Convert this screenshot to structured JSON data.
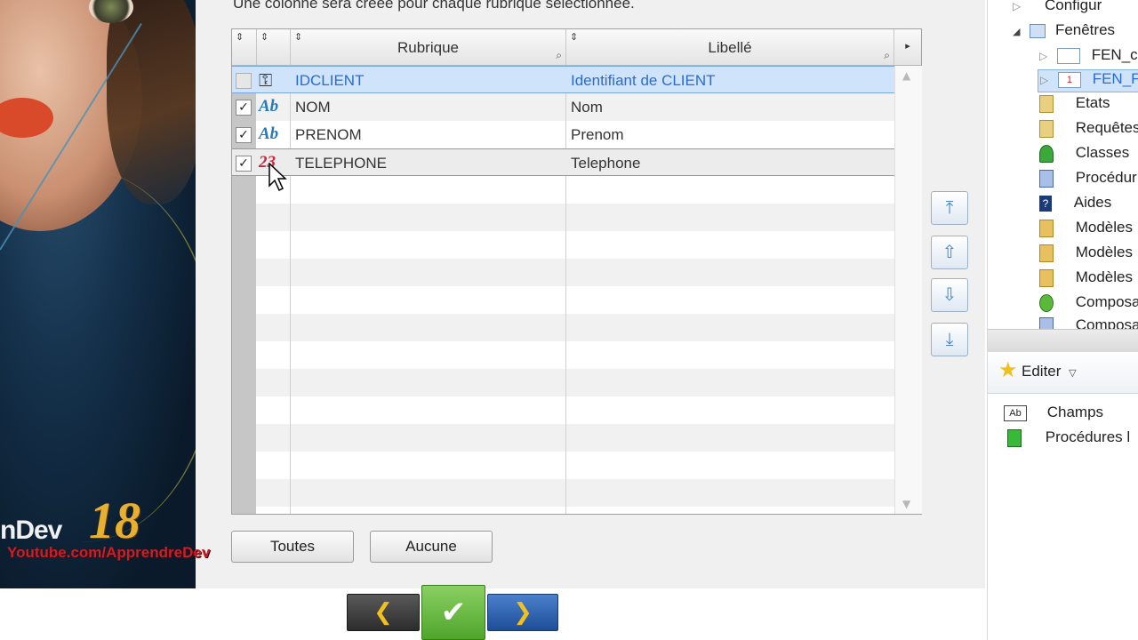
{
  "left_banner": {
    "product_text": "nDev",
    "version_text": "18",
    "watermark": "Youtube.com/ApprendreDev"
  },
  "dialog": {
    "info_text": "Une colonne sera créée pour chaque rubrique sélectionnée.",
    "columns": [
      {
        "label": ""
      },
      {
        "label": ""
      },
      {
        "label": "Rubrique"
      },
      {
        "label": "Libellé"
      }
    ],
    "rows": [
      {
        "checked": false,
        "icon": "key-icon",
        "icon_text": "⚿",
        "rubrique": "IDCLIENT",
        "libelle": "Identifiant de CLIENT",
        "state": "selected"
      },
      {
        "checked": true,
        "icon": "text-field-icon",
        "icon_text": "Ab",
        "rubrique": "NOM",
        "libelle": "Nom",
        "state": "normal"
      },
      {
        "checked": true,
        "icon": "text-field-icon",
        "icon_text": "Ab",
        "rubrique": "PRENOM",
        "libelle": "Prenom",
        "state": "normal"
      },
      {
        "checked": true,
        "icon": "numeric-field-icon",
        "icon_text": "23",
        "rubrique": "TELEPHONE",
        "libelle": "Telephone",
        "state": "highlighted"
      }
    ],
    "buttons": {
      "all_label": "Toutes",
      "none_label": "Aucune"
    },
    "side_buttons": [
      "move-top-icon",
      "move-up-icon",
      "move-down-icon",
      "move-bottom-icon"
    ]
  },
  "wizard_nav": {
    "back": "❮",
    "validate": "✔",
    "next": "❯",
    "colors": {
      "back": "#3c3c3c",
      "validate": "#5fb536",
      "next": "#2b5ea8"
    }
  },
  "project_panel": {
    "tree": [
      {
        "label": "Configur",
        "icon": "config-icon"
      },
      {
        "label": "Fenêtres",
        "icon": "folder-icon"
      },
      {
        "label": "FEN_c",
        "icon": "window-icon"
      },
      {
        "label": "FEN_F",
        "icon": "window-icon"
      },
      {
        "label": "Etats",
        "icon": "report-icon"
      },
      {
        "label": "Requêtes",
        "icon": "query-icon"
      },
      {
        "label": "Classes",
        "icon": "class-icon"
      },
      {
        "label": "Procédur",
        "icon": "procedure-icon"
      },
      {
        "label": "Aides",
        "icon": "help-icon"
      },
      {
        "label": "Modèles",
        "icon": "template-icon"
      },
      {
        "label": "Modèles",
        "icon": "template-icon"
      },
      {
        "label": "Modèles",
        "icon": "template-icon"
      },
      {
        "label": "Composa",
        "icon": "component-icon"
      },
      {
        "label": "Composa",
        "icon": "component-icon"
      }
    ],
    "edit_label": "Editer",
    "lower_items": [
      {
        "label": "Champs",
        "icon": "field-icon"
      },
      {
        "label": "Procédures l",
        "icon": "procedure-icon"
      }
    ]
  }
}
